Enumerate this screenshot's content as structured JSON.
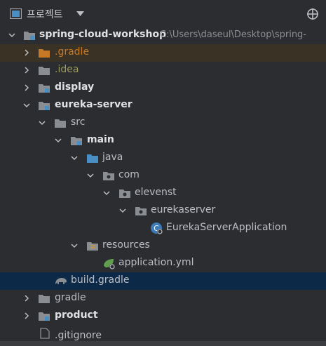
{
  "header": {
    "title": "프로젝트"
  },
  "tree": [
    {
      "label": "spring-cloud-workshop",
      "path": "C:\\Users\\daseul\\Desktop\\spring-"
    },
    {
      "label": ".gradle"
    },
    {
      "label": ".idea"
    },
    {
      "label": "display"
    },
    {
      "label": "eureka-server"
    },
    {
      "label": "src"
    },
    {
      "label": "main"
    },
    {
      "label": "java"
    },
    {
      "label": "com"
    },
    {
      "label": "elevenst"
    },
    {
      "label": "eurekaserver"
    },
    {
      "label": "EurekaServerApplication"
    },
    {
      "label": "resources"
    },
    {
      "label": "application.yml"
    },
    {
      "label": "build.gradle"
    },
    {
      "label": "gradle"
    },
    {
      "label": "product"
    },
    {
      "label": ".gitignore"
    }
  ],
  "colors": {
    "background": "#2b2d30",
    "selected_row": "#0d2948",
    "excluded_row": "#3a3224",
    "folder": "#8a8d92",
    "source_root": "#4a8fc4",
    "module_marker": "#4a8fc4",
    "orange": "#c57825"
  }
}
